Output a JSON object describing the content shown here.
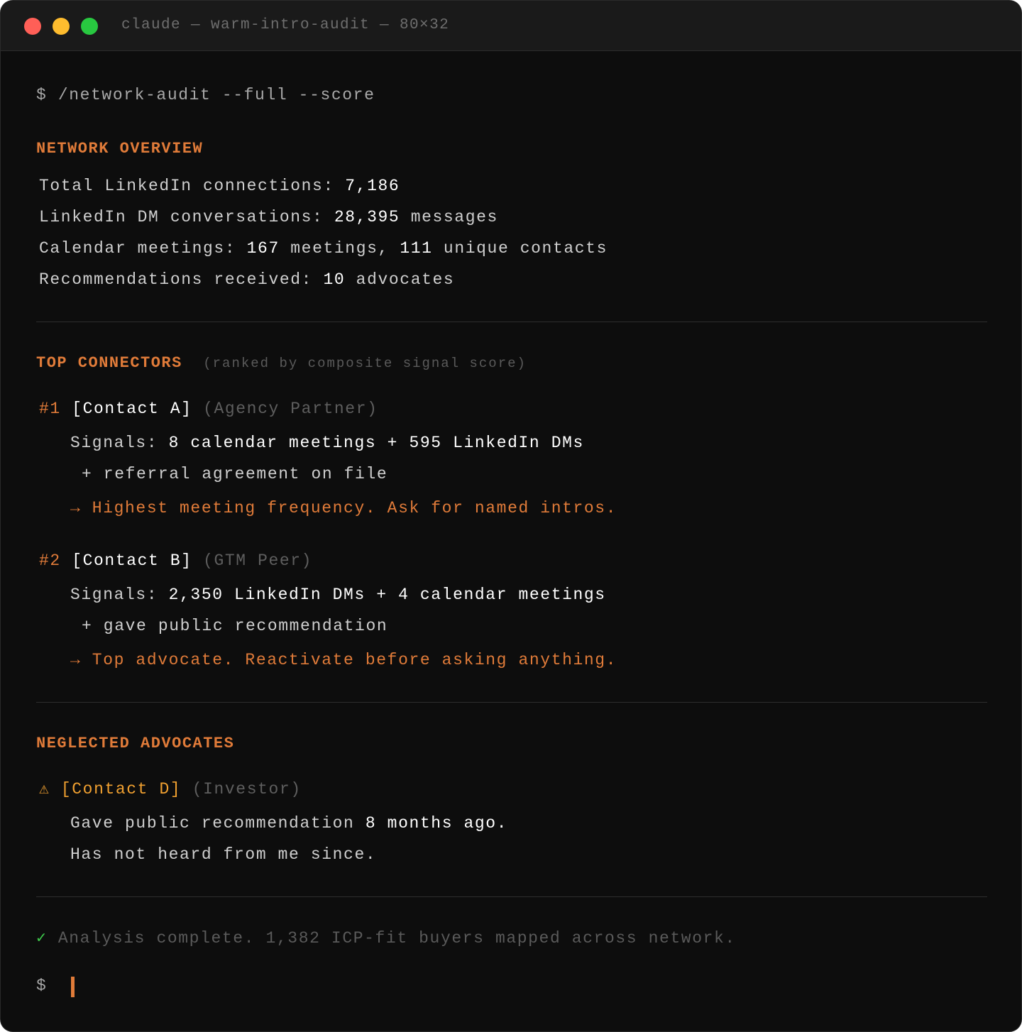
{
  "window": {
    "title": "claude — warm-intro-audit — 80×32",
    "controls": [
      "close",
      "minimize",
      "maximize"
    ]
  },
  "command": {
    "prompt": "$",
    "text": "/network-audit --full --score"
  },
  "overview": {
    "heading": "NETWORK OVERVIEW",
    "rows": [
      {
        "label": "Total LinkedIn connections: ",
        "value": "7,186"
      },
      {
        "label": "LinkedIn DM conversations: ",
        "value": "28,395",
        "suffix": " messages"
      },
      {
        "label": "Calendar meetings: ",
        "value": "167",
        "mid": " meetings, ",
        "value2": "111",
        "suffix": " unique contacts"
      },
      {
        "label": "Recommendations received: ",
        "value": "10",
        "suffix": " advocates"
      }
    ]
  },
  "connectors": {
    "heading": "TOP CONNECTORS",
    "note": "(ranked by composite signal score)",
    "items": [
      {
        "rank": "#1",
        "name": "[Contact A]",
        "role": "(Agency Partner)",
        "signals_label": "Signals: ",
        "signals": "8 calendar meetings + 595 LinkedIn DMs",
        "extra": "+ referral agreement on file",
        "action": "→ Highest meeting frequency. Ask for named intros."
      },
      {
        "rank": "#2",
        "name": "[Contact B]",
        "role": "(GTM Peer)",
        "signals_label": "Signals: ",
        "signals": "2,350 LinkedIn DMs + 4 calendar meetings",
        "extra": "+ gave public recommendation",
        "action": "→ Top advocate. Reactivate before asking anything."
      }
    ]
  },
  "neglected": {
    "heading": "NEGLECTED ADVOCATES",
    "items": [
      {
        "icon": "⚠",
        "name": "[Contact D]",
        "role": "(Investor)",
        "line1_a": "Gave public recommendation ",
        "line1_b": "8 months ago.",
        "line2": "Has not heard from me since."
      }
    ]
  },
  "status": {
    "icon": "✓",
    "text": "Analysis complete. 1,382 ICP-fit buyers mapped across network."
  },
  "final_prompt": "$",
  "colors": {
    "accent": "#e07b39",
    "warning": "#f0a030",
    "success": "#3cc44a",
    "background": "#0d0d0d"
  }
}
